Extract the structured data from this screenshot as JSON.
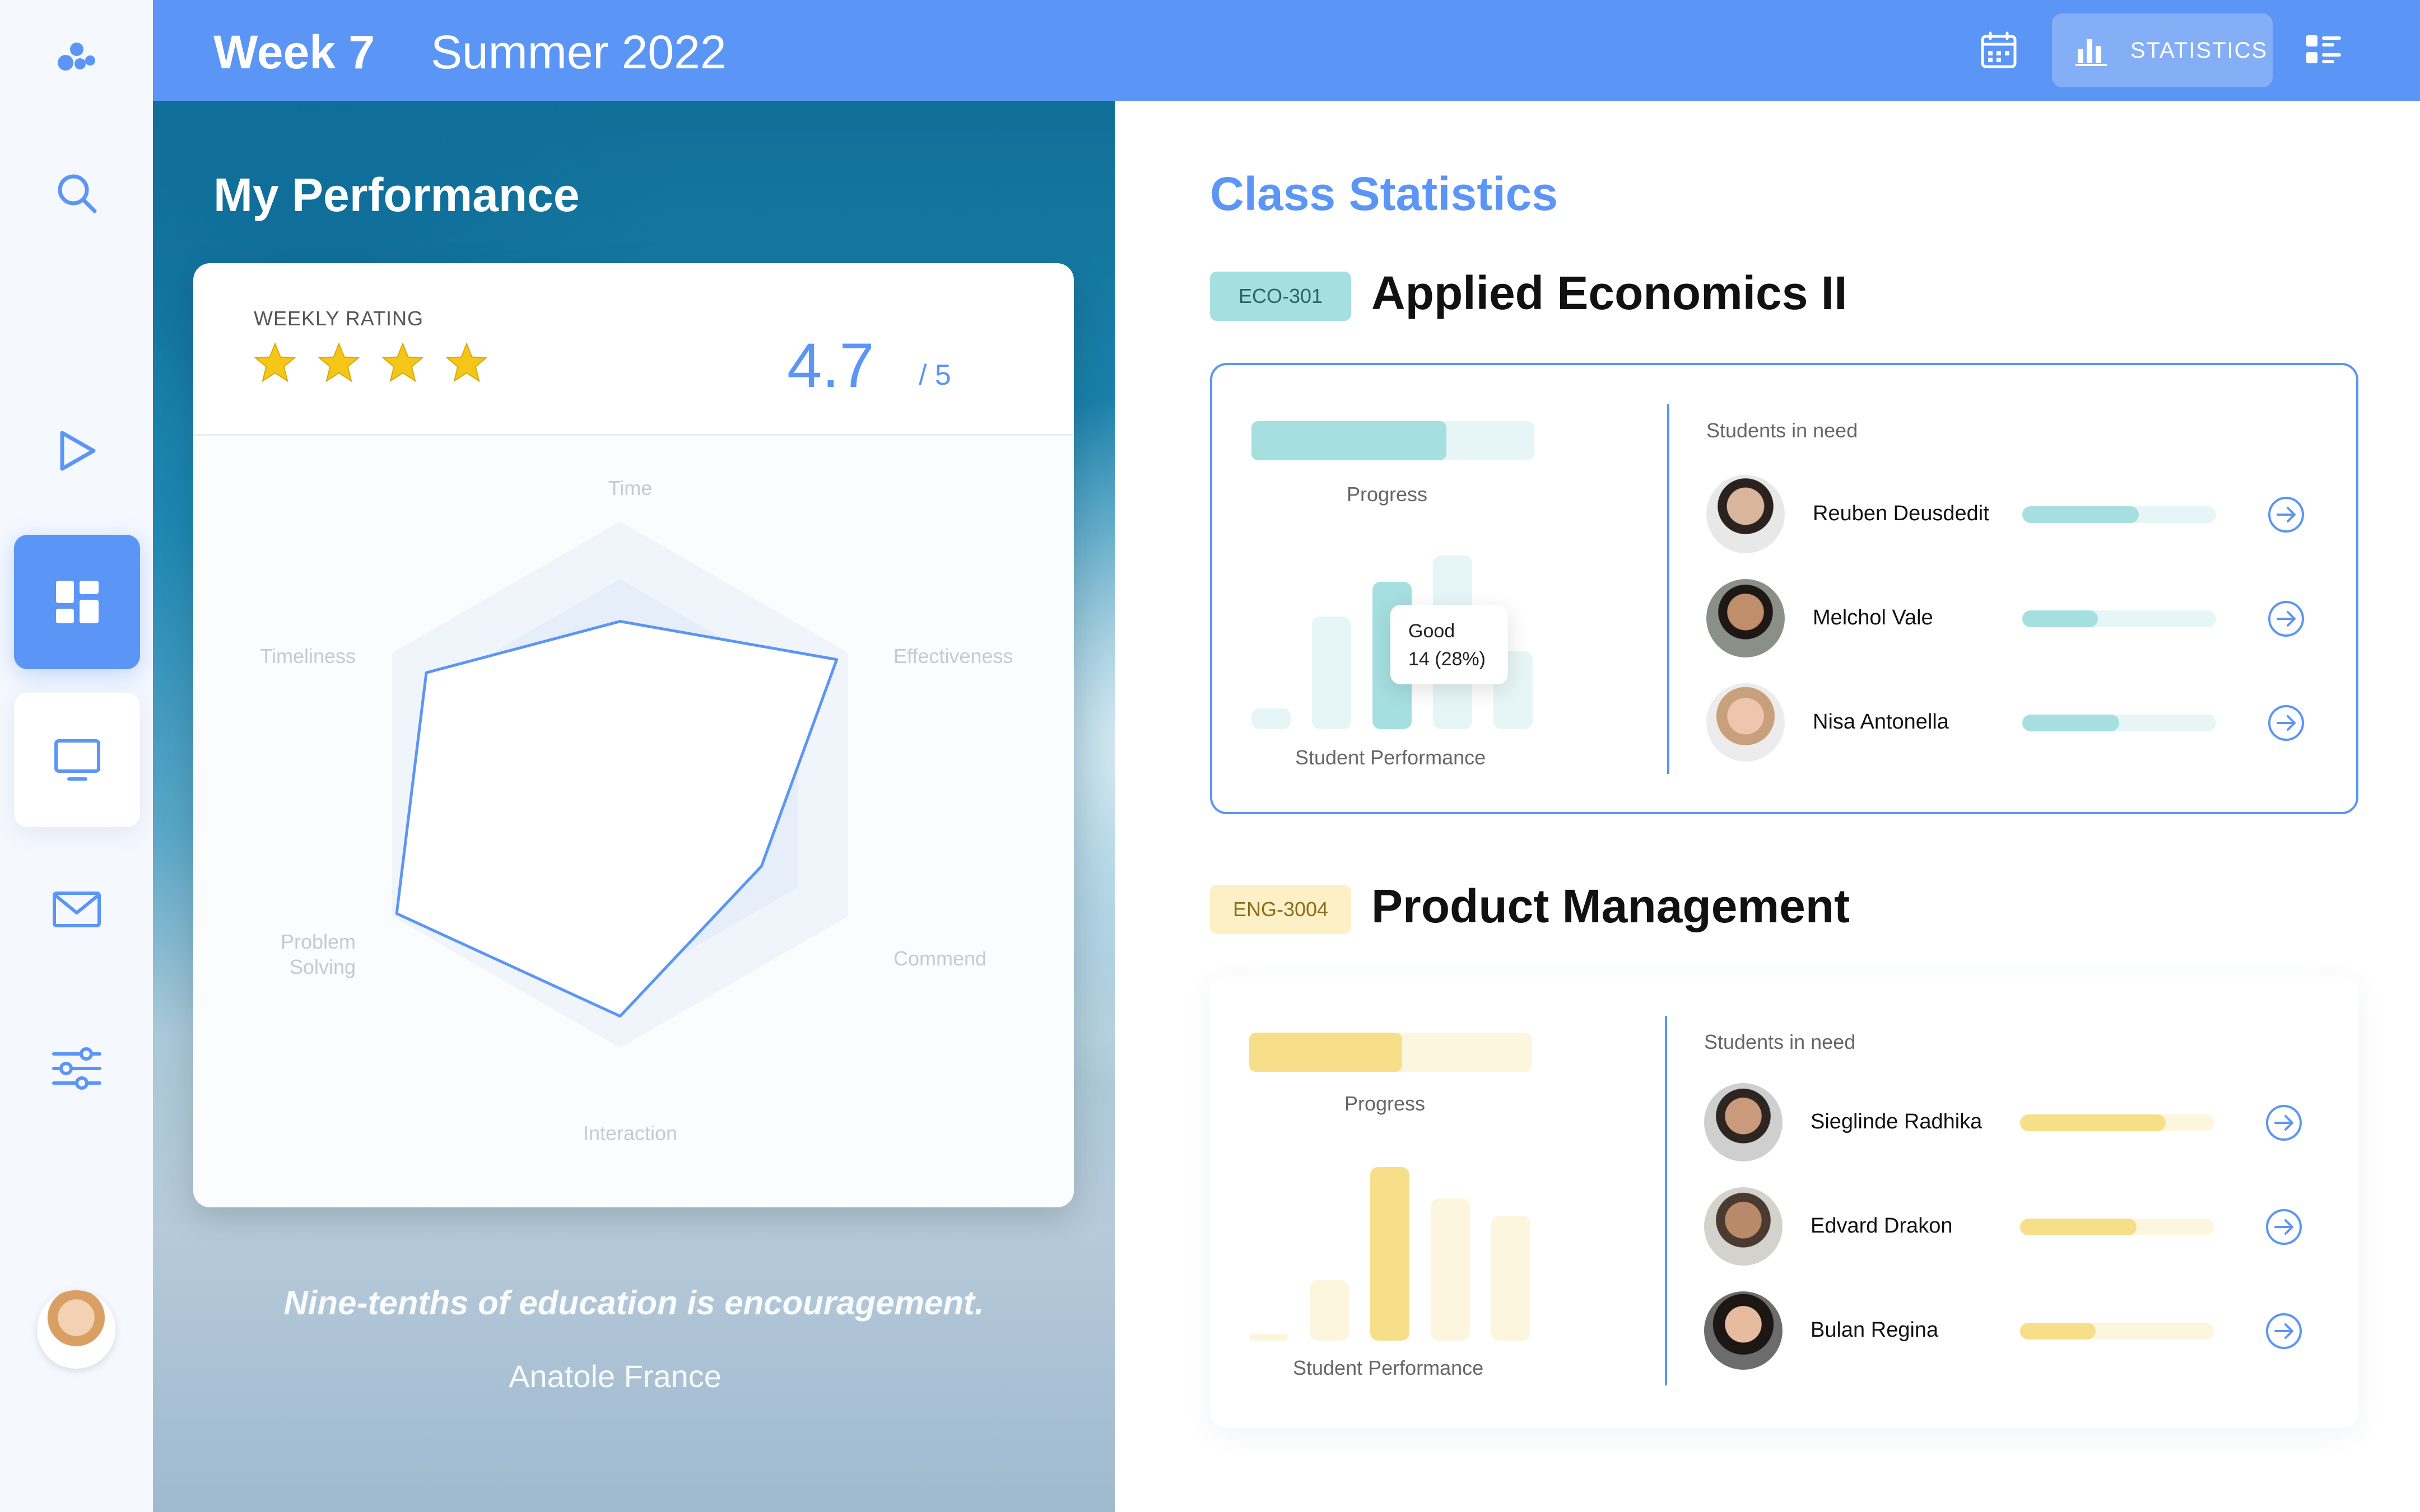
{
  "sidebar": {
    "icons": [
      "logo-icon",
      "search-icon",
      "play-icon",
      "dashboard-icon",
      "monitor-icon",
      "mail-icon",
      "sliders-icon"
    ],
    "active": "dashboard-icon"
  },
  "header": {
    "week": "Week 7",
    "season": "Summer 2022",
    "statistics_label": "STATISTICS",
    "accent_color": "#5b95f5"
  },
  "performance": {
    "title": "My Performance",
    "weekly_rating_label": "WEEKLY RATING",
    "stars_filled": 4,
    "rating": "4.7",
    "rating_max": "/ 5",
    "radar_axes": [
      "Time",
      "Effectiveness",
      "Commend",
      "Interaction",
      "Problem Solving",
      "Timeliness"
    ],
    "radar_labels": {
      "time": "Time",
      "effectiveness": "Effectiveness",
      "commend": "Commend",
      "interaction": "Interaction",
      "problem": "Problem",
      "solving": "Solving",
      "timeliness": "Timeliness"
    },
    "radar_values": [
      0.62,
      0.95,
      0.62,
      0.88,
      0.98,
      0.85
    ],
    "quote": "Nine-tenths of education is encouragement.",
    "author": "Anatole France"
  },
  "class_statistics": {
    "title": "Class Statistics",
    "courses": [
      {
        "code": "ECO-301",
        "name": "Applied Economics II",
        "color": "#a6dfe0",
        "light": "#e6f6f6",
        "progress_label": "Progress",
        "progress": 0.69,
        "performance_label": "Student Performance",
        "performance_bars": [
          0.12,
          0.65,
          0.85,
          1.0,
          0.45
        ],
        "highlight_index": 2,
        "tooltip_grade": "Good",
        "tooltip_value": "14 (28%)",
        "students_label": "Students in need",
        "students": [
          {
            "name": "Reuben Deusdedit",
            "progress": 0.6
          },
          {
            "name": "Melchol Vale",
            "progress": 0.39
          },
          {
            "name": "Nisa Antonella",
            "progress": 0.5
          }
        ]
      },
      {
        "code": "ENG-3004",
        "name": "Product Management",
        "color": "#f7df8a",
        "light": "#fdf6df",
        "progress_label": "Progress",
        "progress": 0.54,
        "performance_label": "Student Performance",
        "performance_bars": [
          0.04,
          0.35,
          1.0,
          0.82,
          0.72
        ],
        "students_label": "Students in need",
        "students": [
          {
            "name": "Sieglinde Radhika",
            "progress": 0.75
          },
          {
            "name": "Edvard Drakon",
            "progress": 0.6
          },
          {
            "name": "Bulan Regina",
            "progress": 0.39
          }
        ]
      }
    ]
  }
}
